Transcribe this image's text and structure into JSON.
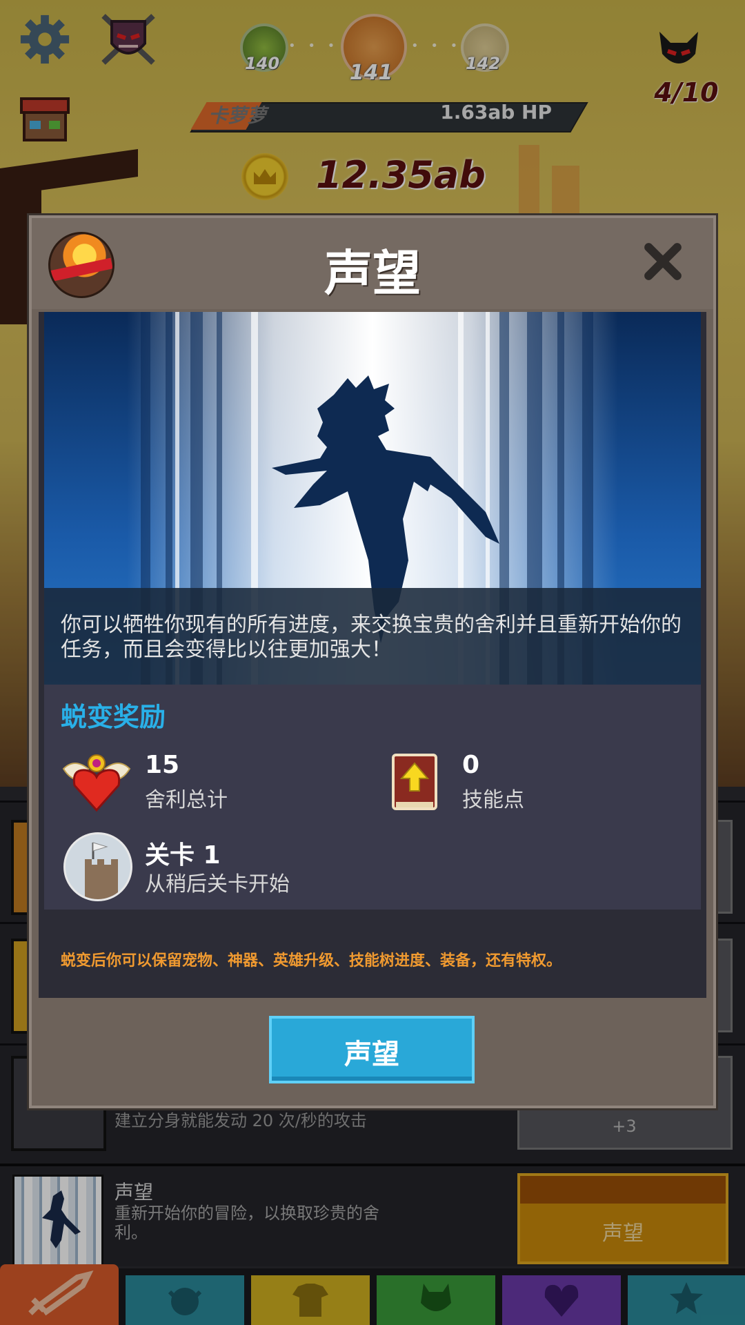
{
  "hud": {
    "stages": [
      "140",
      "141",
      "142"
    ],
    "enemy_name": "卡萝萝",
    "enemy_hp": "1.63ab HP",
    "gold": "12.35ab",
    "enemy_count": "4/10"
  },
  "underlying": {
    "row_desc": "建立分身就能发动 20 次/秒的攻击",
    "row_btn_text": "+3",
    "prestige_row": {
      "title": "声望",
      "desc": "重新开始你的冒险，以换取珍贵的舍利。",
      "button": "声望"
    }
  },
  "tabs": [
    "sword-icon",
    "viking-icon",
    "shirt-icon",
    "pet-icon",
    "heart-shield-icon",
    "star-icon"
  ],
  "modal": {
    "title": "声望",
    "description": "你可以牺牲你现有的所有进度，来交换宝贵的舍利并且重新开始你的任务，而且会变得比以往更加强大！",
    "rewards_title": "蜕变奖励",
    "relics_value": "15",
    "relics_label": "舍利总计",
    "skill_value": "0",
    "skill_label": "技能点",
    "stage_value": "关卡 1",
    "stage_label": "从稍后关卡开始",
    "footer_note": "蜕变后你可以保留宠物、神器、英雄升级、技能树进度、装备，还有特权。",
    "button": "声望"
  },
  "colors": {
    "accent_blue": "#29a8d8",
    "reward_title": "#29b0e8",
    "note_orange": "#f09a30",
    "gold_button": "#c98a0a"
  }
}
